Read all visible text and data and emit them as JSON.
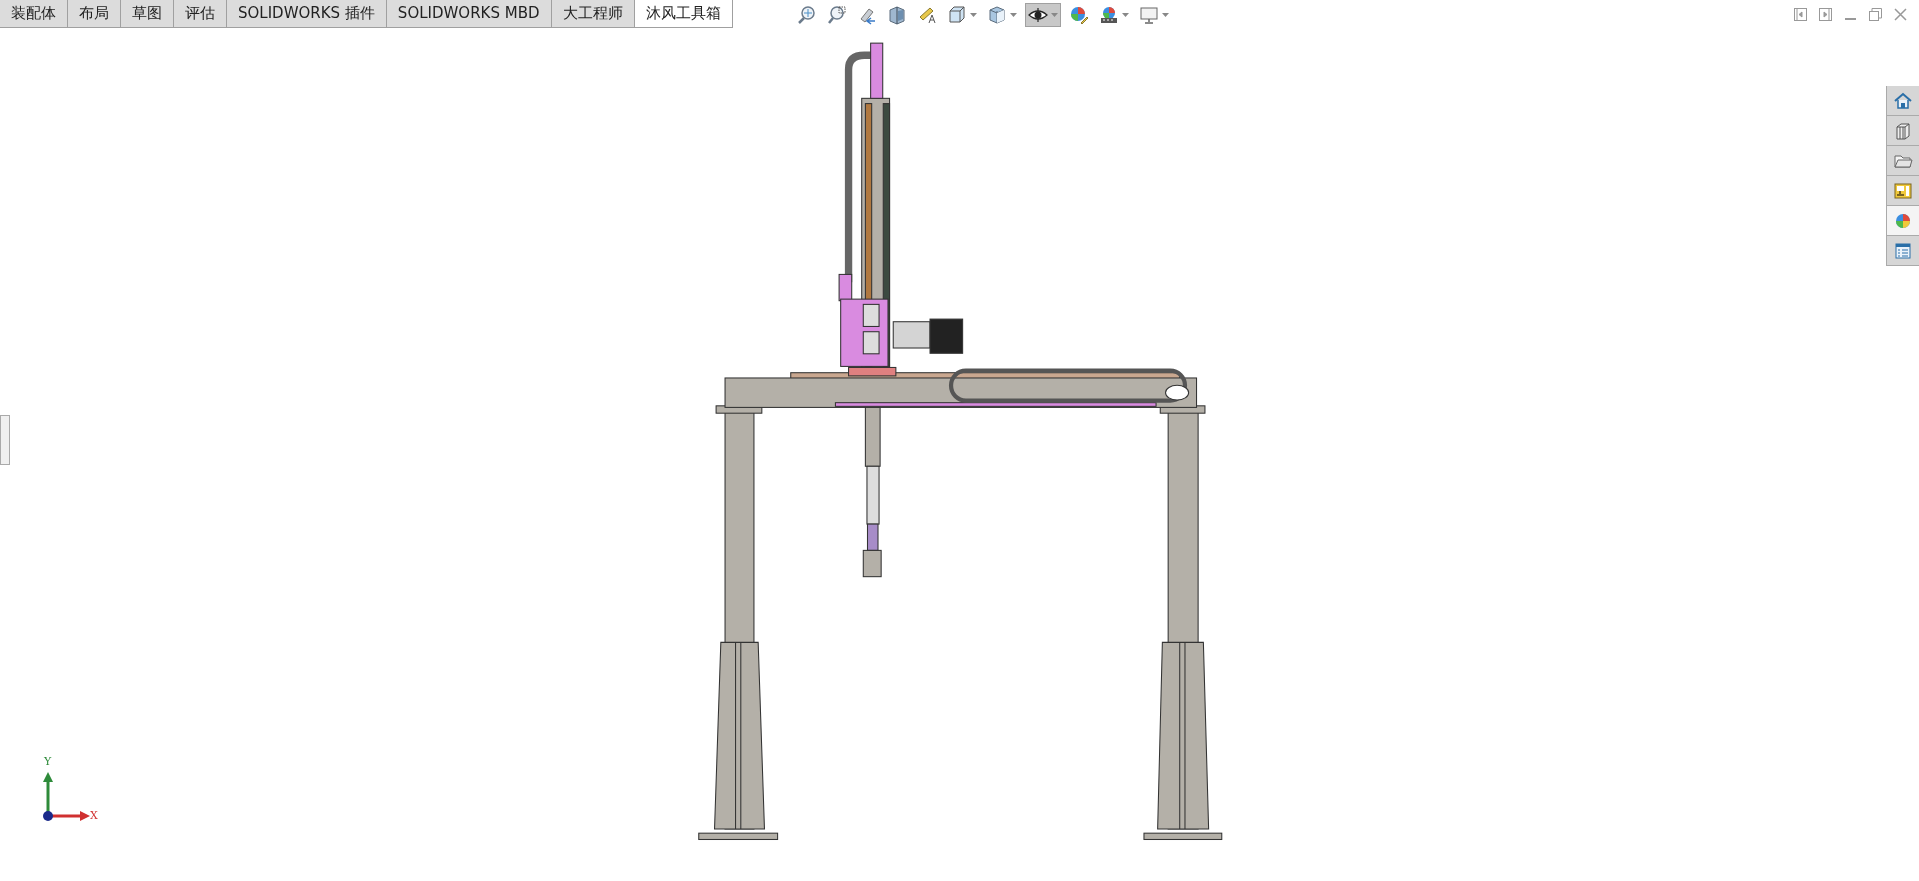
{
  "tabs": [
    {
      "label": "装配体",
      "selected": false
    },
    {
      "label": "布局",
      "selected": false
    },
    {
      "label": "草图",
      "selected": false
    },
    {
      "label": "评估",
      "selected": false
    },
    {
      "label": "SOLIDWORKS 插件",
      "selected": false
    },
    {
      "label": "SOLIDWORKS MBD",
      "selected": false
    },
    {
      "label": "大工程师",
      "selected": false
    },
    {
      "label": "沐风工具箱",
      "selected": true
    }
  ],
  "view_toolbar": [
    {
      "kind": "zoom-fit",
      "dropdown": false,
      "selected": false
    },
    {
      "kind": "zoom-area",
      "dropdown": false,
      "selected": false
    },
    {
      "kind": "previous-view",
      "dropdown": false,
      "selected": false
    },
    {
      "kind": "section-view",
      "dropdown": false,
      "selected": false
    },
    {
      "kind": "annotation-view",
      "dropdown": false,
      "selected": false
    },
    {
      "kind": "view-orientation",
      "dropdown": true,
      "selected": false
    },
    {
      "kind": "display-style",
      "dropdown": true,
      "selected": false
    },
    {
      "kind": "hide-show",
      "dropdown": true,
      "selected": true
    },
    {
      "kind": "edit-appearance",
      "dropdown": false,
      "selected": false
    },
    {
      "kind": "apply-scene",
      "dropdown": true,
      "selected": false
    },
    {
      "kind": "view-settings",
      "dropdown": true,
      "selected": false
    }
  ],
  "task_pane": [
    {
      "kind": "home",
      "selected": false
    },
    {
      "kind": "parts",
      "selected": false
    },
    {
      "kind": "folder",
      "selected": false
    },
    {
      "kind": "view-palette",
      "selected": false
    },
    {
      "kind": "appearance",
      "selected": true
    },
    {
      "kind": "properties",
      "selected": false
    }
  ],
  "triad": {
    "x_label": "X",
    "y_label": "Y"
  }
}
